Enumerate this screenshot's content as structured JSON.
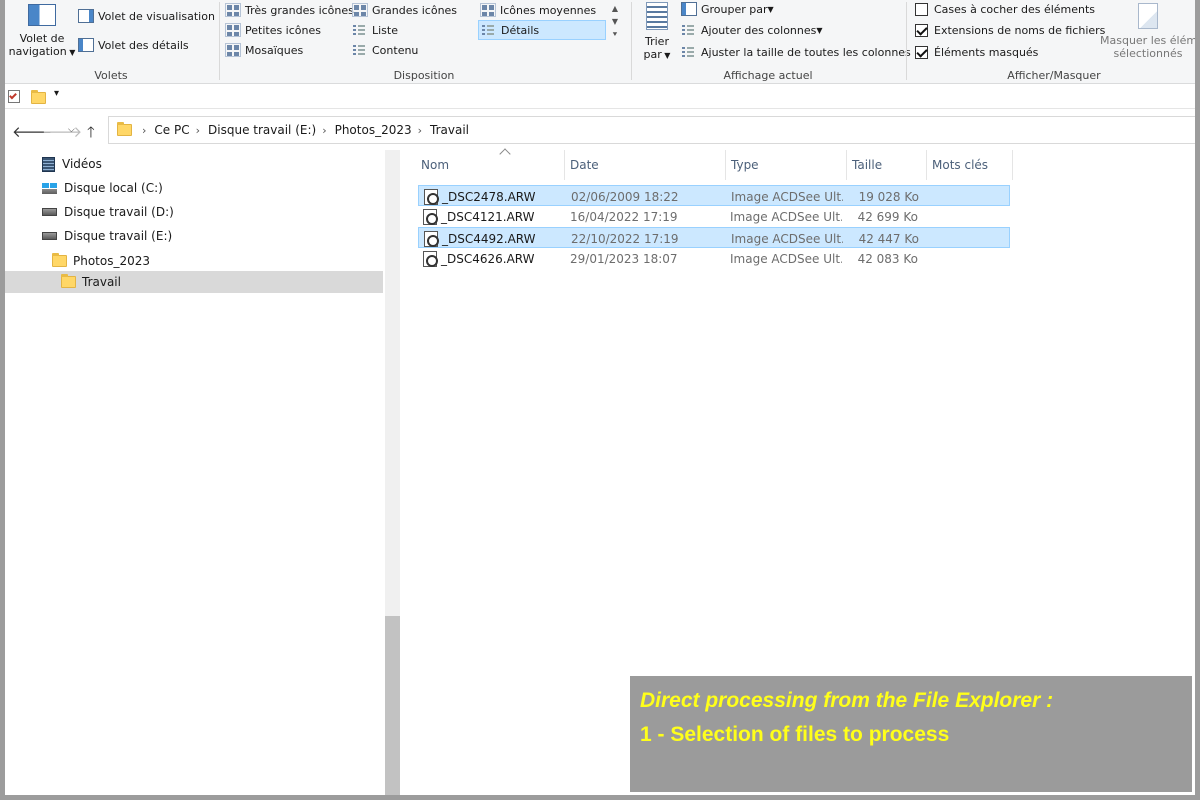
{
  "ribbon": {
    "volets": {
      "title": "Volets",
      "nav_pane_line1": "Volet de",
      "nav_pane_line2": "navigation",
      "preview_pane": "Volet de visualisation",
      "details_pane": "Volet des détails"
    },
    "disposition": {
      "title": "Disposition",
      "items": [
        "Très grandes icônes",
        "Grandes icônes",
        "Icônes moyennes",
        "Petites icônes",
        "Liste",
        "Détails",
        "Mosaïques",
        "Contenu"
      ],
      "selected": "Détails"
    },
    "affichage": {
      "title": "Affichage actuel",
      "sort_line1": "Trier",
      "sort_line2": "par",
      "group_by": "Grouper par",
      "add_columns": "Ajouter des colonnes",
      "fit_columns": "Ajuster la taille de toutes les colonnes"
    },
    "afficher": {
      "title": "Afficher/Masquer",
      "checkboxes": [
        {
          "label": "Cases à cocher des éléments",
          "checked": false
        },
        {
          "label": "Extensions de noms de fichiers",
          "checked": true
        },
        {
          "label": "Éléments masqués",
          "checked": true
        }
      ],
      "hide_selected_line1": "Masquer les éléme",
      "hide_selected_line2": "sélectionnés"
    }
  },
  "breadcrumb": [
    "Ce PC",
    "Disque travail (E:)",
    "Photos_2023",
    "Travail"
  ],
  "nav_pane": {
    "items": [
      {
        "label": "Vidéos",
        "icon": "videos-icon"
      },
      {
        "label": "Disque local (C:)",
        "icon": "windows-drive-icon"
      },
      {
        "label": "Disque travail (D:)",
        "icon": "drive-icon"
      },
      {
        "label": "Disque travail (E:)",
        "icon": "drive-icon"
      },
      {
        "label": "Photos_2023",
        "icon": "folder-icon"
      },
      {
        "label": "Travail",
        "icon": "folder-icon",
        "selected": true
      }
    ]
  },
  "file_list": {
    "columns": [
      "Nom",
      "Date",
      "Type",
      "Taille",
      "Mots clés"
    ],
    "rows": [
      {
        "name": "_DSC2478.ARW",
        "date": "02/06/2009 18:22",
        "type": "Image ACDSee Ult...",
        "size": "19 028 Ko",
        "selected": true
      },
      {
        "name": "_DSC4121.ARW",
        "date": "16/04/2022 17:19",
        "type": "Image ACDSee Ult...",
        "size": "42 699 Ko",
        "selected": false
      },
      {
        "name": "_DSC4492.ARW",
        "date": "22/10/2022 17:19",
        "type": "Image ACDSee Ult...",
        "size": "42 447 Ko",
        "selected": true
      },
      {
        "name": "_DSC4626.ARW",
        "date": "29/01/2023 18:07",
        "type": "Image ACDSee Ult...",
        "size": "42 083 Ko",
        "selected": false
      }
    ]
  },
  "overlay": {
    "line1": "Direct processing from the File Explorer :",
    "line2": "1 - Selection of files to process"
  },
  "colors": {
    "selection_bg": "#cce8ff",
    "selection_border": "#99d1ff",
    "overlay_bg": "#9b9b9b",
    "overlay_text": "#ffff1a",
    "folder": "#ffd767"
  }
}
